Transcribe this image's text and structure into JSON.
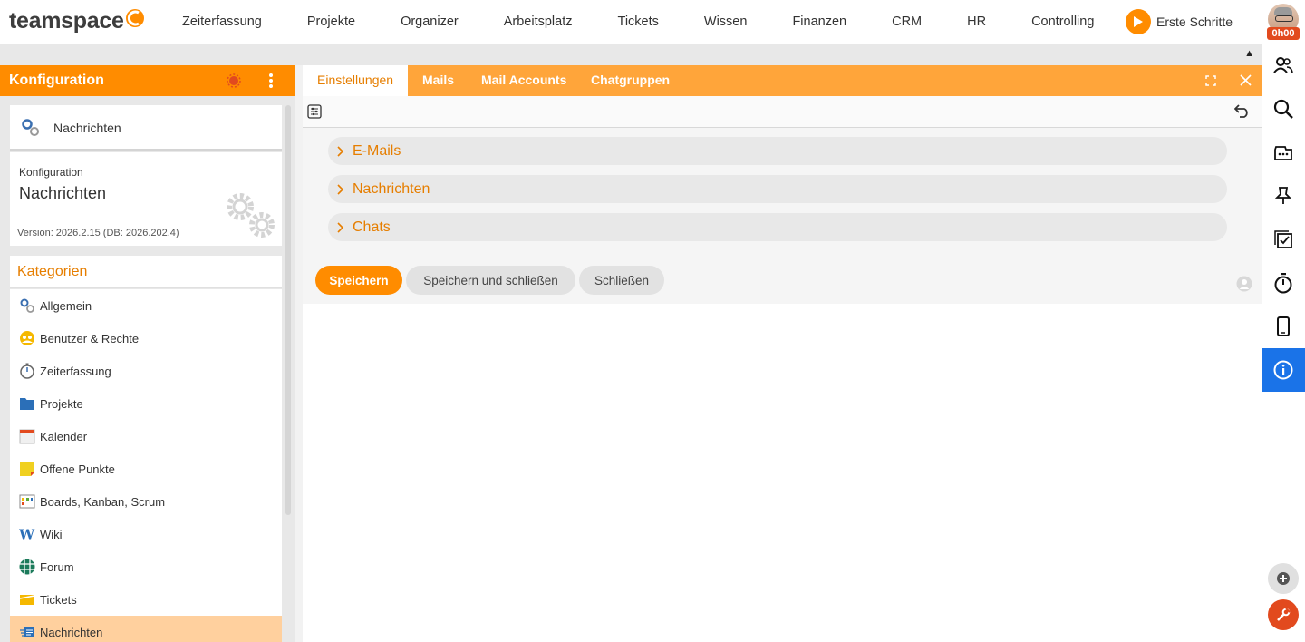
{
  "app": {
    "logo_text": "teamspace",
    "nav": [
      "Zeiterfassung",
      "Projekte",
      "Organizer",
      "Arbeitsplatz",
      "Tickets",
      "Wissen",
      "Finanzen",
      "CRM",
      "HR",
      "Controlling"
    ],
    "erste_schritte": "Erste Schritte",
    "timer": "0h00",
    "accent": "#ff8c00"
  },
  "left": {
    "header_title": "Konfiguration",
    "module_name": "Nachrichten",
    "info_small": "Konfiguration",
    "info_big": "Nachrichten",
    "version": "Version: 2026.2.15 (DB: 2026.202.4)",
    "categories_label": "Kategorien",
    "items": [
      {
        "label": "Allgemein",
        "icon": "gears-icon"
      },
      {
        "label": "Benutzer & Rechte",
        "icon": "users-icon"
      },
      {
        "label": "Zeiterfassung",
        "icon": "stopwatch-icon"
      },
      {
        "label": "Projekte",
        "icon": "folder-icon"
      },
      {
        "label": "Kalender",
        "icon": "calendar-icon"
      },
      {
        "label": "Offene Punkte",
        "icon": "sticky-note-icon"
      },
      {
        "label": "Boards, Kanban, Scrum",
        "icon": "board-icon"
      },
      {
        "label": "Wiki",
        "icon": "wiki-icon"
      },
      {
        "label": "Forum",
        "icon": "forum-icon"
      },
      {
        "label": "Tickets",
        "icon": "ticket-icon"
      },
      {
        "label": "Nachrichten",
        "icon": "messages-icon",
        "selected": true
      }
    ]
  },
  "main": {
    "tabs": [
      "Einstellungen",
      "Mails",
      "Mail Accounts",
      "Chatgruppen"
    ],
    "active_tab": "Einstellungen",
    "sections": [
      "E-Mails",
      "Nachrichten",
      "Chats"
    ],
    "buttons": {
      "save": "Speichern",
      "save_close": "Speichern und schließen",
      "close": "Schließen"
    }
  },
  "rail": {
    "icons": [
      "contacts-icon",
      "search-icon",
      "inbox-icon",
      "pin-icon",
      "tasks-icon",
      "stopwatch-icon",
      "mobile-icon",
      "info-icon"
    ],
    "active": "info-icon"
  }
}
